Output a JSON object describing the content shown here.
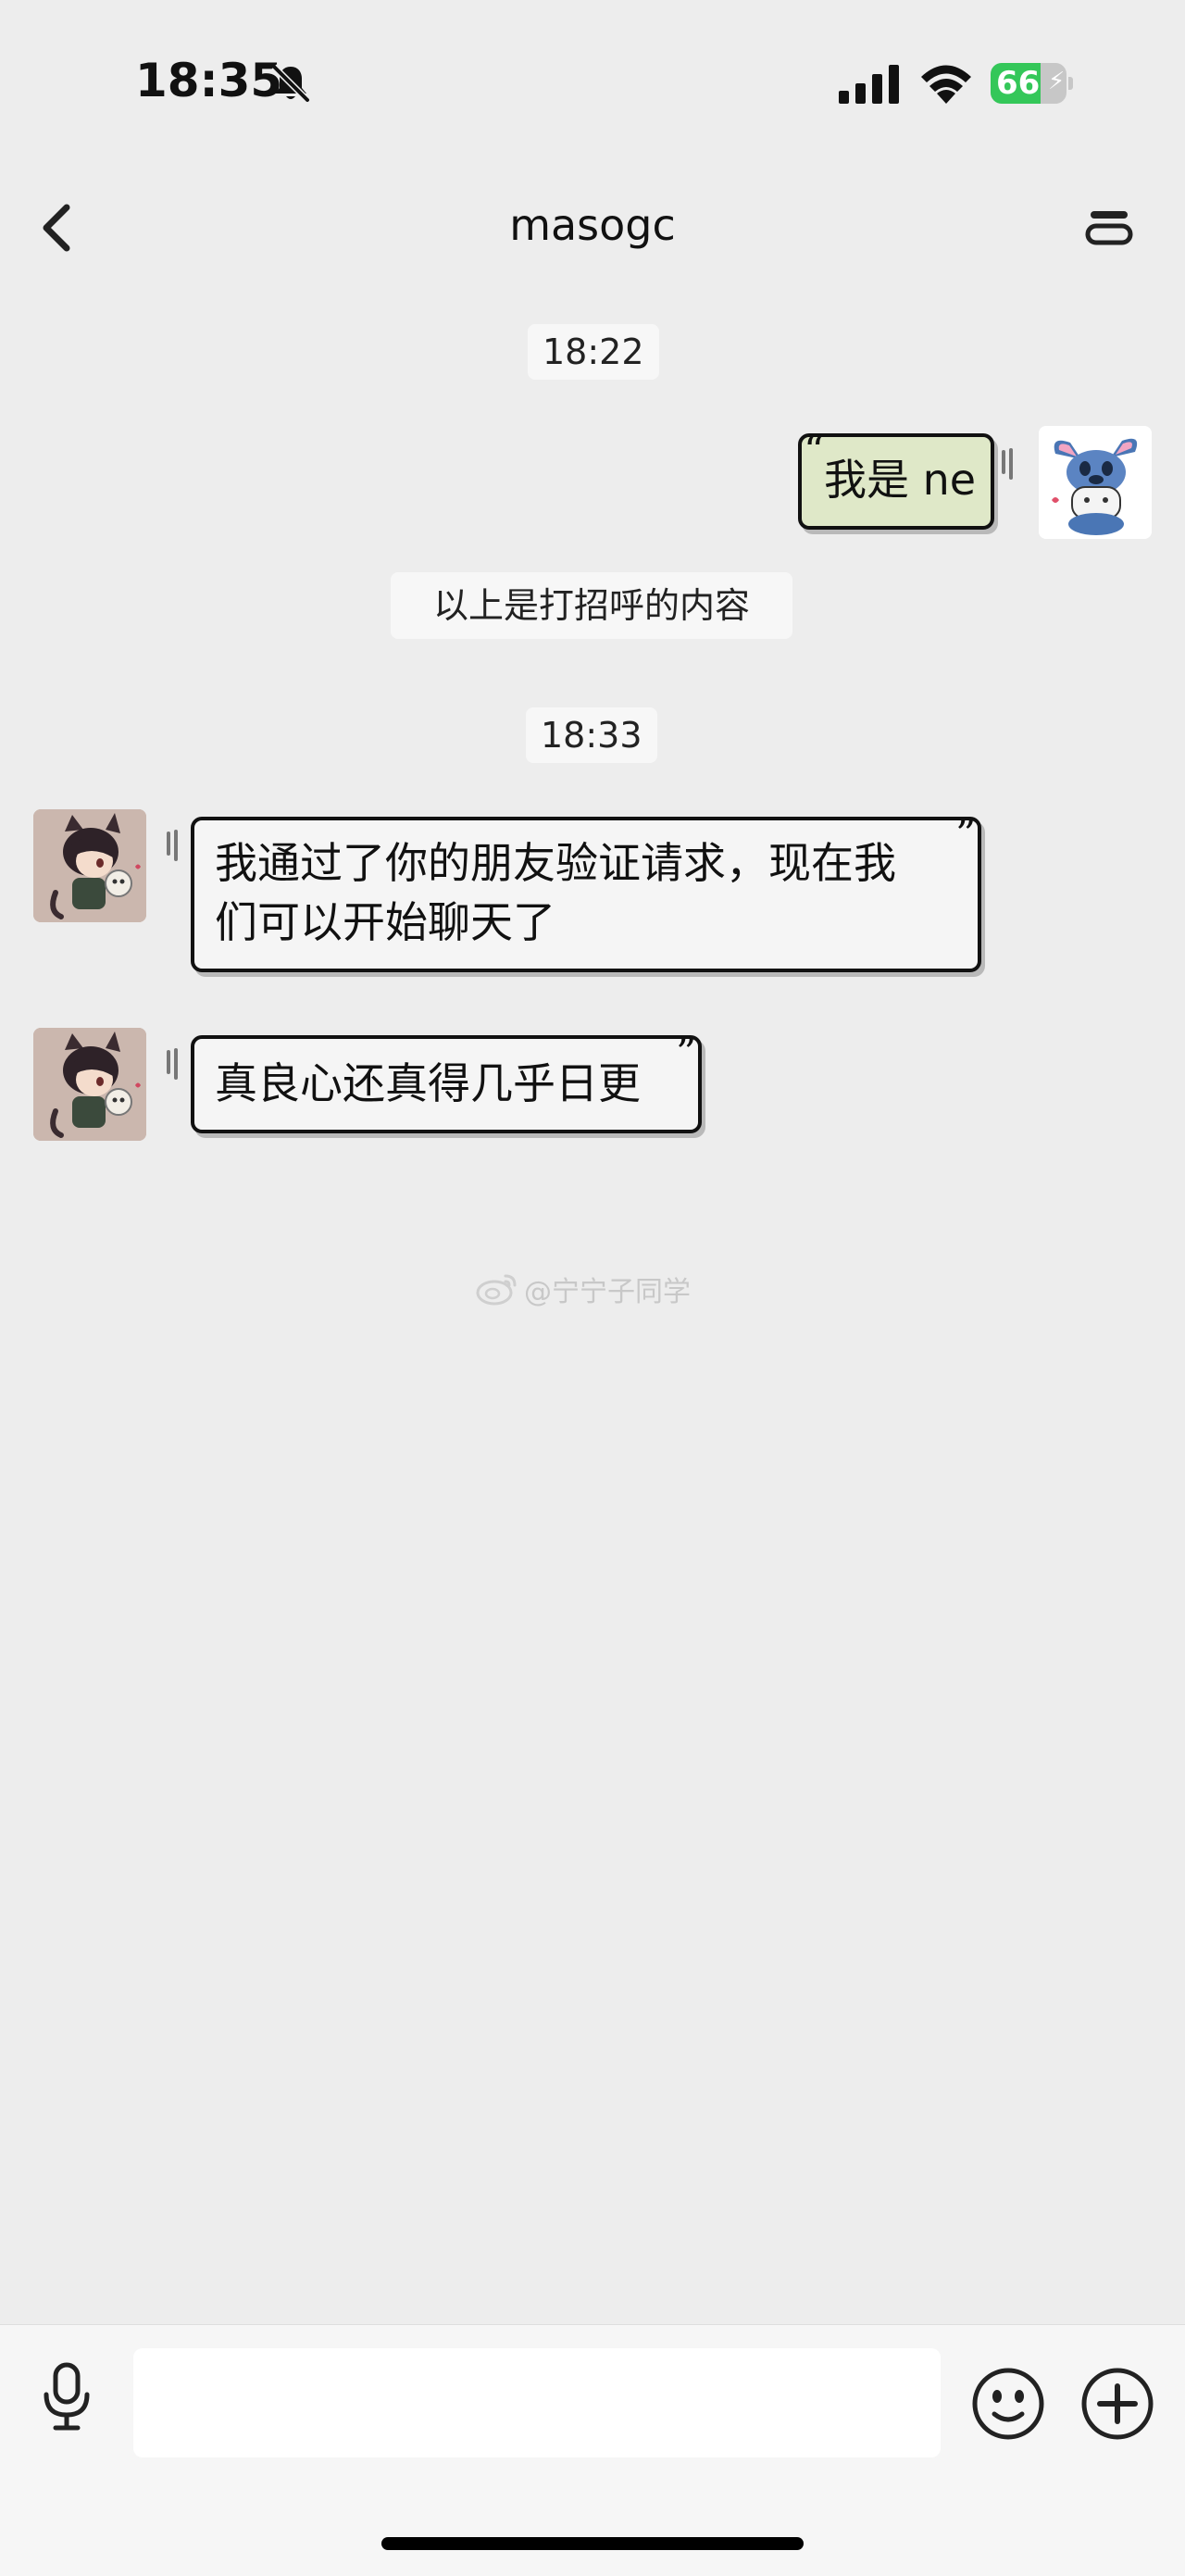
{
  "status_bar": {
    "time": "18:35",
    "battery_level": "66",
    "battery_fraction": 0.66,
    "icons": [
      "bell-slash-icon",
      "cellular-signal-icon",
      "wifi-icon",
      "battery-charging-icon"
    ]
  },
  "nav": {
    "title": "masogc",
    "back_icon": "chevron-left-icon",
    "more_icon": "more-icon"
  },
  "chat": {
    "timestamp_1": "18:22",
    "my_message": "我是 ne",
    "system_notice": "以上是打招呼的内容",
    "timestamp_2": "18:33",
    "peer_message_1_line_1": "我通过了你的朋友验证请求，现在我",
    "peer_message_1_line_2": "们可以开始聊天了",
    "peer_message_2": "真良心还真得几乎日更"
  },
  "watermark": {
    "text": "@宁宁子同学",
    "icon": "weibo-icon"
  },
  "input_bar": {
    "placeholder": "",
    "icons": [
      "microphone-icon",
      "emoji-icon",
      "plus-icon"
    ]
  },
  "colors": {
    "background": "#ededed",
    "my_bubble": "#dfe8c8",
    "peer_bubble": "#f5f5f5",
    "battery_fill": "#34c759"
  }
}
